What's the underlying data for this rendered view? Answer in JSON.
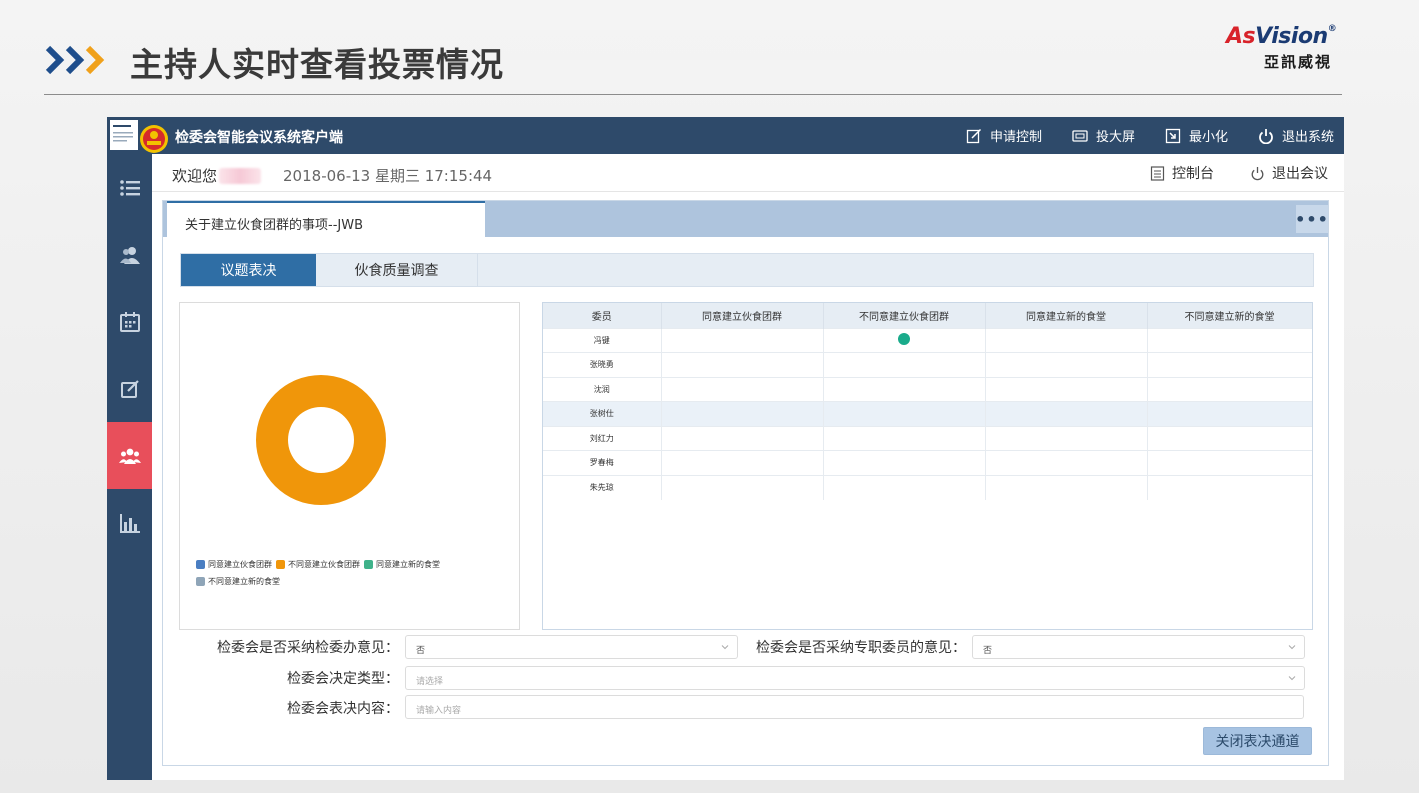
{
  "slide": {
    "title": "主持人实时查看投票情况",
    "logo_prefix": "As",
    "logo_suffix": "Vision",
    "logo_cn": "亞訊威視"
  },
  "window": {
    "app_title": "检委会智能会议系统客户端",
    "actions": [
      "申请控制",
      "投大屏",
      "最小化",
      "退出系统"
    ]
  },
  "sidebar": {
    "items": [
      "list-icon",
      "users-icon",
      "calendar-icon",
      "edit-icon",
      "group-icon",
      "bar-chart-icon"
    ],
    "active_index": 4
  },
  "subbar": {
    "welcome": "欢迎您",
    "datetime": "2018-06-13 星期三 17:15:44",
    "console": "控制台",
    "exit_meeting": "退出会议"
  },
  "panel": {
    "tab": "关于建立伙食团群的事项--JWB",
    "more": "•••"
  },
  "segments": [
    "议题表决",
    "伙食质量调查"
  ],
  "chart_data": {
    "type": "pie",
    "categories": [
      "同意建立伙食团群",
      "不同意建立伙食团群",
      "同意建立新的食堂",
      "不同意建立新的食堂"
    ],
    "values": [
      0,
      1,
      0,
      0
    ],
    "colors": [
      "#4a7ec2",
      "#f0960a",
      "#3fb28a",
      "#8fa5b8"
    ]
  },
  "table": {
    "columns": [
      "委员",
      "同意建立伙食团群",
      "不同意建立伙食团群",
      "同意建立新的食堂",
      "不同意建立新的食堂"
    ],
    "rows": [
      {
        "name": "冯键",
        "vote": 2
      },
      {
        "name": "张晓勇",
        "vote": 0
      },
      {
        "name": "沈润",
        "vote": 0
      },
      {
        "name": "张树仕",
        "vote": 0
      },
      {
        "name": "刘红力",
        "vote": 0
      },
      {
        "name": "罗春梅",
        "vote": 0
      },
      {
        "name": "朱先琼",
        "vote": 0
      }
    ],
    "highlight_row": 3
  },
  "form": {
    "adopt_office_label": "检委会是否采纳检委办意见：",
    "adopt_office_value": "否",
    "adopt_member_label": "检委会是否采纳专职委员的意见：",
    "adopt_member_value": "否",
    "decision_type_label": "检委会决定类型：",
    "decision_type_placeholder": "请选择",
    "content_label": "检委会表决内容：",
    "content_placeholder": "请输入内容",
    "close_button": "关闭表决通道"
  }
}
